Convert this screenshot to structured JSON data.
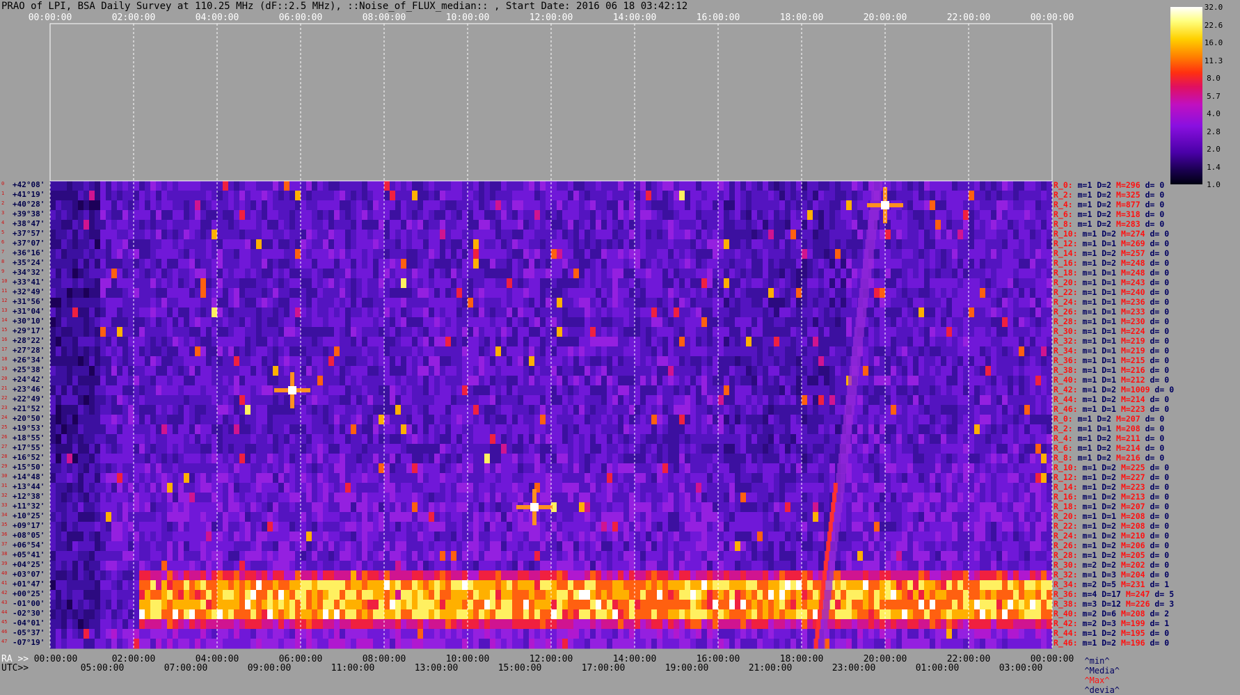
{
  "title": "PRAO of LPI, BSA Daily Survey at 110.25 MHz (dF::2.5 MHz), ::Noise_of_FLUX_median:: , Start Date: 2016 06 18 03:42:12",
  "chart_data": {
    "type": "heatmap",
    "top_time_ticks": [
      "00:00:00",
      "02:00:00",
      "04:00:00",
      "06:00:00",
      "08:00:00",
      "10:00:00",
      "12:00:00",
      "14:00:00",
      "16:00:00",
      "18:00:00",
      "20:00:00",
      "22:00:00",
      "00:00:00"
    ],
    "ra_label": "RA >>",
    "ra_ticks": [
      "00:00:00",
      "02:00:00",
      "04:00:00",
      "06:00:00",
      "08:00:00",
      "10:00:00",
      "12:00:00",
      "14:00:00",
      "16:00:00",
      "18:00:00",
      "20:00:00",
      "22:00:00",
      "00:00:00"
    ],
    "utc_label": "UTC>>",
    "utc_ticks": [
      "05:00:00",
      "07:00:00",
      "09:00:00",
      "11:00:00",
      "13:00:00",
      "15:00:00",
      "17:00:00",
      "19:00:00",
      "21:00:00",
      "23:00:00",
      "01:00:00",
      "03:00:00"
    ],
    "declinations": [
      "+42°08'",
      "+41°19'",
      "+40°28'",
      "+39°38'",
      "+38°47'",
      "+37°57'",
      "+37°07'",
      "+36°16'",
      "+35°24'",
      "+34°32'",
      "+33°41'",
      "+32°49'",
      "+31°56'",
      "+31°04'",
      "+30°10'",
      "+29°17'",
      "+28°22'",
      "+27°28'",
      "+26°34'",
      "+25°38'",
      "+24°42'",
      "+23°46'",
      "+22°49'",
      "+21°52'",
      "+20°50'",
      "+19°53'",
      "+18°55'",
      "+17°55'",
      "+16°52'",
      "+15°50'",
      "+14°48'",
      "+13°44'",
      "+12°38'",
      "+11°32'",
      "+10°25'",
      "+09°17'",
      "+08°05'",
      "+06°54'",
      "+05°41'",
      "+04°25'",
      "+03°07'",
      "+01°47'",
      "+00°25'",
      "-01°00'",
      "-02°30'",
      "-04°01'",
      "-05°37'",
      "-07°19'"
    ],
    "row_numbers": [
      "0",
      "1",
      "2",
      "3",
      "4",
      "5",
      "6",
      "7",
      "8",
      "9",
      "10",
      "11",
      "12",
      "13",
      "14",
      "15",
      "16",
      "17",
      "18",
      "19",
      "20",
      "21",
      "22",
      "23",
      "24",
      "25",
      "26",
      "27",
      "28",
      "29",
      "30",
      "31",
      "32",
      "33",
      "34",
      "35",
      "36",
      "37",
      "38",
      "39",
      "40",
      "41",
      "42",
      "43",
      "44",
      "45",
      "46",
      "47"
    ],
    "row_stats": [
      {
        "r": "R_0:",
        "m": "m=1",
        "D": "D=2",
        "M": "M=296",
        "d": "d= 0"
      },
      {
        "r": "R_2:",
        "m": "m=1",
        "D": "D=2",
        "M": "M=325",
        "d": "d= 0"
      },
      {
        "r": "R_4:",
        "m": "m=1",
        "D": "D=2",
        "M": "M=877",
        "d": "d= 0"
      },
      {
        "r": "R_6:",
        "m": "m=1",
        "D": "D=2",
        "M": "M=318",
        "d": "d= 0"
      },
      {
        "r": "R_8:",
        "m": "m=1",
        "D": "D=2",
        "M": "M=283",
        "d": "d= 0"
      },
      {
        "r": "R_10:",
        "m": "m=1",
        "D": "D=2",
        "M": "M=274",
        "d": "d= 0"
      },
      {
        "r": "R_12:",
        "m": "m=1",
        "D": "D=1",
        "M": "M=269",
        "d": "d= 0"
      },
      {
        "r": "R_14:",
        "m": "m=1",
        "D": "D=2",
        "M": "M=257",
        "d": "d= 0"
      },
      {
        "r": "R_16:",
        "m": "m=1",
        "D": "D=2",
        "M": "M=248",
        "d": "d= 0"
      },
      {
        "r": "R_18:",
        "m": "m=1",
        "D": "D=1",
        "M": "M=248",
        "d": "d= 0"
      },
      {
        "r": "R_20:",
        "m": "m=1",
        "D": "D=1",
        "M": "M=243",
        "d": "d= 0"
      },
      {
        "r": "R_22:",
        "m": "m=1",
        "D": "D=1",
        "M": "M=240",
        "d": "d= 0"
      },
      {
        "r": "R_24:",
        "m": "m=1",
        "D": "D=1",
        "M": "M=236",
        "d": "d= 0"
      },
      {
        "r": "R_26:",
        "m": "m=1",
        "D": "D=1",
        "M": "M=233",
        "d": "d= 0"
      },
      {
        "r": "R_28:",
        "m": "m=1",
        "D": "D=1",
        "M": "M=230",
        "d": "d= 0"
      },
      {
        "r": "R_30:",
        "m": "m=1",
        "D": "D=1",
        "M": "M=224",
        "d": "d= 0"
      },
      {
        "r": "R_32:",
        "m": "m=1",
        "D": "D=1",
        "M": "M=219",
        "d": "d= 0"
      },
      {
        "r": "R_34:",
        "m": "m=1",
        "D": "D=1",
        "M": "M=219",
        "d": "d= 0"
      },
      {
        "r": "R_36:",
        "m": "m=1",
        "D": "D=1",
        "M": "M=215",
        "d": "d= 0"
      },
      {
        "r": "R_38:",
        "m": "m=1",
        "D": "D=1",
        "M": "M=216",
        "d": "d= 0"
      },
      {
        "r": "R_40:",
        "m": "m=1",
        "D": "D=1",
        "M": "M=212",
        "d": "d= 0"
      },
      {
        "r": "R_42:",
        "m": "m=1",
        "D": "D=2",
        "M": "M=1009",
        "d": "d= 0"
      },
      {
        "r": "R_44:",
        "m": "m=1",
        "D": "D=2",
        "M": "M=214",
        "d": "d= 0"
      },
      {
        "r": "R_46:",
        "m": "m=1",
        "D": "D=1",
        "M": "M=223",
        "d": "d= 0"
      },
      {
        "r": "R_0:",
        "m": "m=1",
        "D": "D=2",
        "M": "M=207",
        "d": "d= 0"
      },
      {
        "r": "R_2:",
        "m": "m=1",
        "D": "D=1",
        "M": "M=208",
        "d": "d= 0"
      },
      {
        "r": "R_4:",
        "m": "m=1",
        "D": "D=2",
        "M": "M=211",
        "d": "d= 0"
      },
      {
        "r": "R_6:",
        "m": "m=1",
        "D": "D=2",
        "M": "M=214",
        "d": "d= 0"
      },
      {
        "r": "R_8:",
        "m": "m=1",
        "D": "D=2",
        "M": "M=216",
        "d": "d= 0"
      },
      {
        "r": "R_10:",
        "m": "m=1",
        "D": "D=2",
        "M": "M=225",
        "d": "d= 0"
      },
      {
        "r": "R_12:",
        "m": "m=1",
        "D": "D=2",
        "M": "M=227",
        "d": "d= 0"
      },
      {
        "r": "R_14:",
        "m": "m=1",
        "D": "D=2",
        "M": "M=223",
        "d": "d= 0"
      },
      {
        "r": "R_16:",
        "m": "m=1",
        "D": "D=2",
        "M": "M=213",
        "d": "d= 0"
      },
      {
        "r": "R_18:",
        "m": "m=1",
        "D": "D=2",
        "M": "M=207",
        "d": "d= 0"
      },
      {
        "r": "R_20:",
        "m": "m=1",
        "D": "D=1",
        "M": "M=208",
        "d": "d= 0"
      },
      {
        "r": "R_22:",
        "m": "m=1",
        "D": "D=2",
        "M": "M=208",
        "d": "d= 0"
      },
      {
        "r": "R_24:",
        "m": "m=1",
        "D": "D=2",
        "M": "M=210",
        "d": "d= 0"
      },
      {
        "r": "R_26:",
        "m": "m=1",
        "D": "D=2",
        "M": "M=206",
        "d": "d= 0"
      },
      {
        "r": "R_28:",
        "m": "m=1",
        "D": "D=2",
        "M": "M=205",
        "d": "d= 0"
      },
      {
        "r": "R_30:",
        "m": "m=2",
        "D": "D=2",
        "M": "M=202",
        "d": "d= 0"
      },
      {
        "r": "R_32:",
        "m": "m=1",
        "D": "D=3",
        "M": "M=204",
        "d": "d= 0"
      },
      {
        "r": "R_34:",
        "m": "m=2",
        "D": "D=5",
        "M": "M=231",
        "d": "d= 1"
      },
      {
        "r": "R_36:",
        "m": "m=4",
        "D": "D=17",
        "M": "M=247",
        "d": "d= 5"
      },
      {
        "r": "R_38:",
        "m": "m=3",
        "D": "D=12",
        "M": "M=226",
        "d": "d= 3"
      },
      {
        "r": "R_40:",
        "m": "m=2",
        "D": "D=6",
        "M": "M=208",
        "d": "d= 2"
      },
      {
        "r": "R_42:",
        "m": "m=2",
        "D": "D=3",
        "M": "M=199",
        "d": "d= 1"
      },
      {
        "r": "R_44:",
        "m": "m=1",
        "D": "D=2",
        "M": "M=195",
        "d": "d= 0"
      },
      {
        "r": "R_46:",
        "m": "m=1",
        "D": "D=2",
        "M": "M=196",
        "d": "d= 0"
      }
    ],
    "colorbar_ticks": [
      "32.0",
      "22.6",
      "16.0",
      "11.3",
      "8.0",
      "5.7",
      "4.0",
      "2.8",
      "2.0",
      "1.4",
      "1.0"
    ],
    "legend": {
      "min": "^min^",
      "media": "^Media^",
      "max": "^Max^",
      "devia": "^devia^"
    },
    "bright_band_rows": [
      41,
      42,
      43,
      44
    ],
    "hot_spots": [
      {
        "time_h": 5.8,
        "row": 21
      },
      {
        "time_h": 20.0,
        "row": 2
      },
      {
        "time_h": 11.6,
        "row": 33
      }
    ],
    "colors": {
      "max_color": "#ff1010",
      "min_color": "#000060",
      "media_color": "#000060",
      "devia_color": "#000060"
    }
  }
}
